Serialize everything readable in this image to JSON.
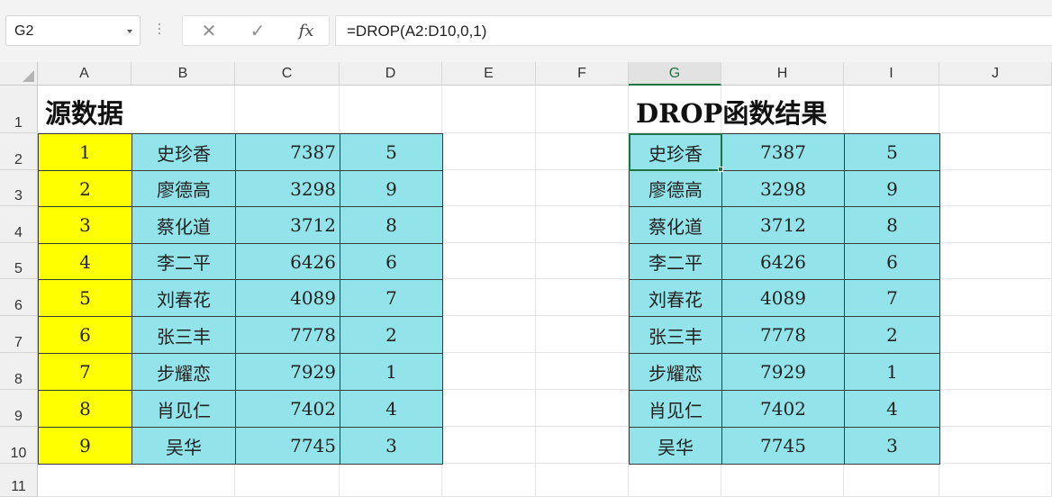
{
  "formula_bar": {
    "name_box": "G2",
    "cancel_glyph": "✕",
    "enter_glyph": "✓",
    "fx_label": "fx",
    "formula": "=DROP(A2:D10,0,1)"
  },
  "columns": [
    "A",
    "B",
    "C",
    "D",
    "E",
    "F",
    "G",
    "H",
    "I",
    "J"
  ],
  "active_column": "G",
  "rows": [
    "1",
    "2",
    "3",
    "4",
    "5",
    "6",
    "7",
    "8",
    "9",
    "10",
    "11"
  ],
  "source": {
    "title": "源数据",
    "rows": [
      [
        "1",
        "史珍香",
        "7387",
        "5"
      ],
      [
        "2",
        "廖德高",
        "3298",
        "9"
      ],
      [
        "3",
        "蔡化道",
        "3712",
        "8"
      ],
      [
        "4",
        "李二平",
        "6426",
        "6"
      ],
      [
        "5",
        "刘春花",
        "4089",
        "7"
      ],
      [
        "6",
        "张三丰",
        "7778",
        "2"
      ],
      [
        "7",
        "步耀恋",
        "7929",
        "1"
      ],
      [
        "8",
        "肖见仁",
        "7402",
        "4"
      ],
      [
        "9",
        "吴华",
        "7745",
        "3"
      ]
    ]
  },
  "result": {
    "title": "DROP函数结果",
    "rows": [
      [
        "史珍香",
        "7387",
        "5"
      ],
      [
        "廖德高",
        "3298",
        "9"
      ],
      [
        "蔡化道",
        "3712",
        "8"
      ],
      [
        "李二平",
        "6426",
        "6"
      ],
      [
        "刘春花",
        "4089",
        "7"
      ],
      [
        "张三丰",
        "7778",
        "2"
      ],
      [
        "步耀恋",
        "7929",
        "1"
      ],
      [
        "肖见仁",
        "7402",
        "4"
      ],
      [
        "吴华",
        "7745",
        "3"
      ]
    ]
  },
  "colors": {
    "yellow_fill": "#ffff00",
    "cyan_fill": "#93e4ea",
    "selection": "#217346"
  }
}
